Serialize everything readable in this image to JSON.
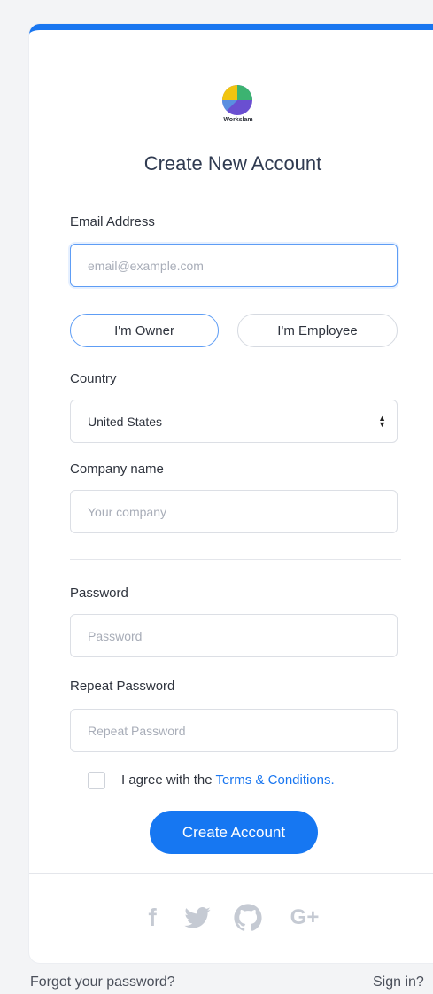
{
  "brand": {
    "name": "Workslam"
  },
  "form": {
    "title": "Create New Account",
    "email": {
      "label": "Email Address",
      "placeholder": "email@example.com"
    },
    "role_options": [
      "I'm Owner",
      "I'm Employee"
    ],
    "selected_role": "I'm Owner",
    "country": {
      "label": "Country",
      "value": "United States"
    },
    "company": {
      "label": "Company name",
      "placeholder": "Your company"
    },
    "password": {
      "label": "Password",
      "placeholder": "Password"
    },
    "repeat_password": {
      "label": "Repeat Password",
      "placeholder": "Repeat Password"
    },
    "agree": {
      "text": "I agree with the ",
      "link": "Terms & Conditions."
    },
    "submit": "Create Account"
  },
  "social": {
    "facebook": "f",
    "twitter": "twitter-icon",
    "github": "github-icon",
    "google": "G+"
  },
  "footer": {
    "forgot": "Forgot your password?",
    "signin": "Sign in?"
  },
  "colors": {
    "accent": "#1976f0",
    "social_icon": "#c5cad3"
  }
}
